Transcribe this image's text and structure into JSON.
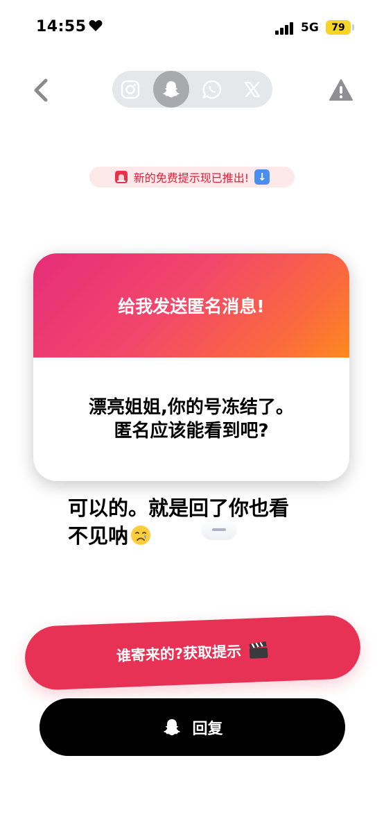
{
  "status": {
    "time": "14:55",
    "network": "5G",
    "battery": "79"
  },
  "nav": {
    "tabs": [
      {
        "name": "instagram",
        "icon": "instagram-icon"
      },
      {
        "name": "snapchat",
        "icon": "snapchat-ghost-icon",
        "active": true
      },
      {
        "name": "whatsapp",
        "icon": "whatsapp-icon"
      },
      {
        "name": "x",
        "icon": "x-icon"
      }
    ]
  },
  "banner": {
    "text": "新的免费提示现已推出!"
  },
  "card": {
    "header": "给我发送匿名消息!",
    "message_line1": "漂亮姐姐,你的号冻结了。",
    "message_line2": "匿名应该能看到吧?"
  },
  "reply_overlay": {
    "line1": "可以的。就是回了你也看",
    "line2": "不见呐"
  },
  "buttons": {
    "hint_label": "谁寄来的?获取提示",
    "reply_label": "回复"
  },
  "colors": {
    "accent": "#e73255",
    "card_gradient_start": "#e62d7a",
    "card_gradient_end": "#fd8a1f",
    "banner_text": "#d9223a"
  }
}
